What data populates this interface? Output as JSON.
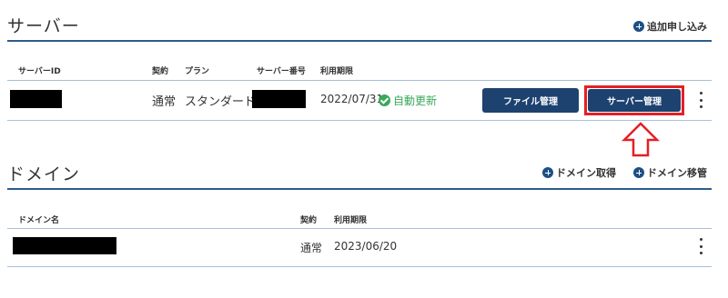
{
  "server": {
    "title": "サーバー",
    "add_link": "追加申し込み",
    "columns": {
      "server_id": "サーバーID",
      "contract": "契約",
      "plan": "プラン",
      "server_number": "サーバー番号",
      "period": "利用期限"
    },
    "row": {
      "contract": "通常",
      "plan": "スタンダード",
      "period": "2022/07/31",
      "status": "自動更新",
      "file_button": "ファイル管理",
      "server_button": "サーバー管理"
    }
  },
  "domain": {
    "title": "ドメイン",
    "acquire_link": "ドメイン取得",
    "transfer_link": "ドメイン移管",
    "columns": {
      "name": "ドメイン名",
      "contract": "契約",
      "period": "利用期限"
    },
    "row": {
      "contract": "通常",
      "period": "2023/06/20"
    }
  },
  "colors": {
    "accent": "#1d4270",
    "rule": "#2d5c8c",
    "status_green": "#3aa85a",
    "highlight_red": "#e61e25"
  },
  "icons": {
    "add": "plus-circle-icon",
    "status": "check-circle-icon",
    "menu": "kebab-menu-icon",
    "pointer": "up-arrow-icon"
  }
}
